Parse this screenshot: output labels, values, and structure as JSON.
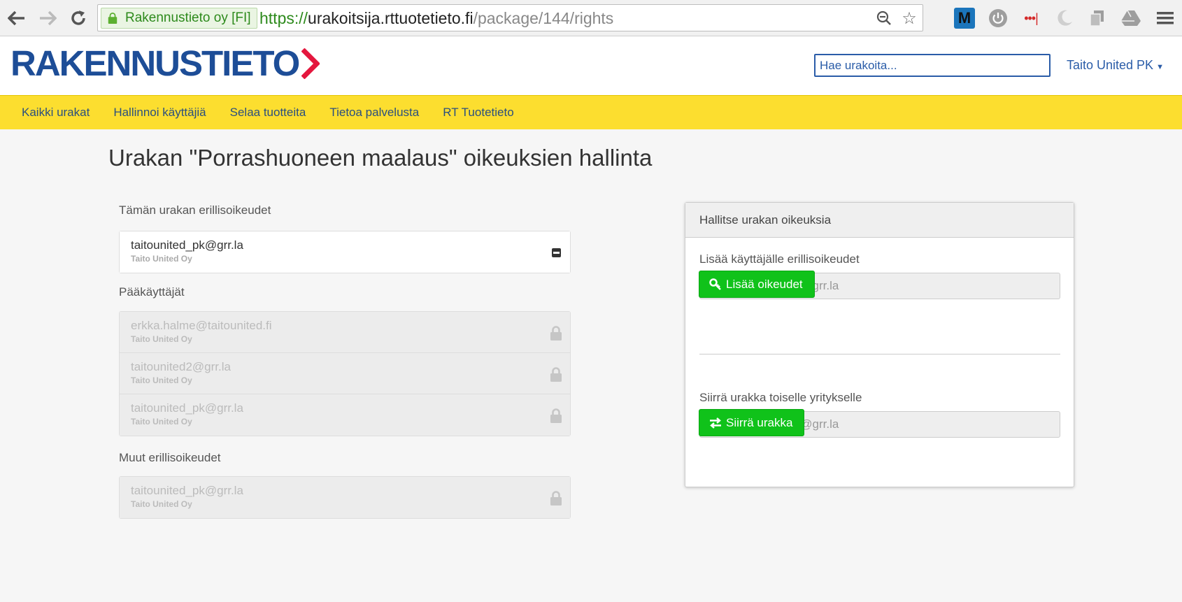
{
  "browser": {
    "site_identity": "Rakennustieto oy [FI]",
    "url_scheme": "https://",
    "url_host": "urakoitsija.rttuotetieto.fi",
    "url_path": "/package/144/rights",
    "extension_m_label": "M"
  },
  "header": {
    "logo_text": "RAKENNUSTIETO",
    "search_placeholder": "Hae urakoita...",
    "user_name": "Taito United PK"
  },
  "nav": {
    "items": [
      {
        "label": "Kaikki urakat"
      },
      {
        "label": "Hallinnoi käyttäjiä"
      },
      {
        "label": "Selaa tuotteita"
      },
      {
        "label": "Tietoa palvelusta"
      },
      {
        "label": "RT Tuotetieto"
      }
    ]
  },
  "main": {
    "title": "Urakan \"Porrashuoneen maalaus\" oikeuksien hallinta",
    "special_rights": {
      "label": "Tämän urakan erillisoikeudet",
      "items": [
        {
          "email": "taitounited_pk@grr.la",
          "company": "Taito United Oy"
        }
      ]
    },
    "admins": {
      "label": "Pääkäyttäjät",
      "items": [
        {
          "email": "erkka.halme@taitounited.fi",
          "company": "Taito United Oy"
        },
        {
          "email": "taitounited2@grr.la",
          "company": "Taito United Oy"
        },
        {
          "email": "taitounited_pk@grr.la",
          "company": "Taito United Oy"
        }
      ]
    },
    "other_rights": {
      "label": "Muut erillisoikeudet",
      "items": [
        {
          "email": "taitounited_pk@grr.la",
          "company": "Taito United Oy"
        }
      ]
    }
  },
  "panel": {
    "heading": "Hallitse urakan oikeuksia",
    "add": {
      "label": "Lisää käyttäjälle erillisoikeudet",
      "placeholder": "matti.meikalainen@grr.la",
      "button": "Lisää oikeudet"
    },
    "transfer": {
      "label": "Siirrä urakka toiselle yritykselle",
      "placeholder": "matti.meikalainen@grr.la",
      "button": "Siirrä urakka"
    }
  },
  "colors": {
    "brand_blue": "#1d4d97",
    "brand_red": "#e4173e",
    "nav_yellow": "#fcde2f",
    "button_green": "#10c21a"
  }
}
